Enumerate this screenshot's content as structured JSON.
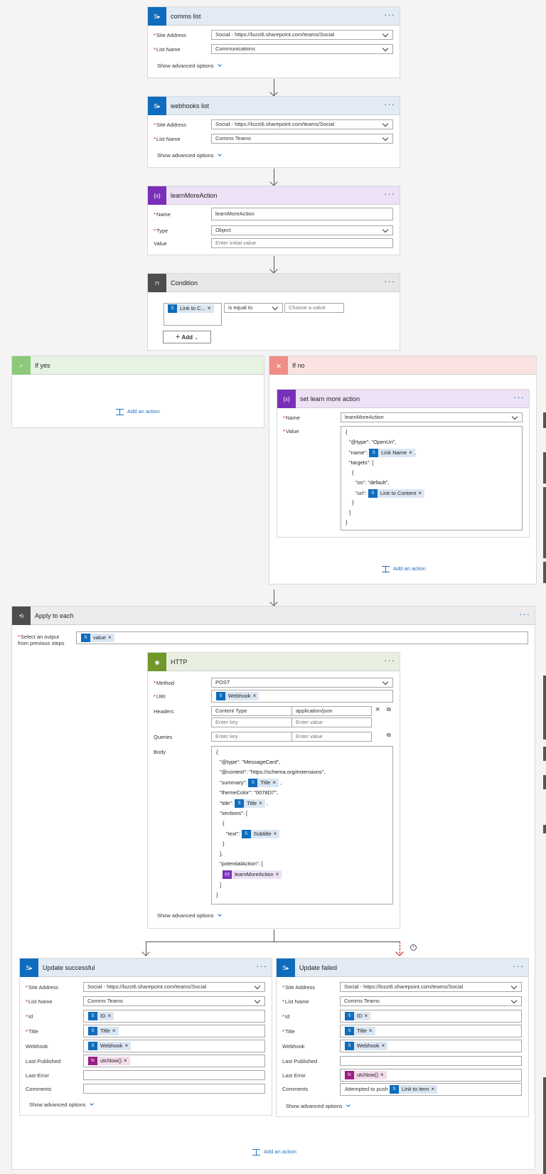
{
  "comms": {
    "title": "comms list",
    "site_label": "Site Address",
    "site_value": "Social - https://lozzi6.sharepoint.com/teams/Social",
    "list_label": "List Name",
    "list_value": "Communications",
    "advanced": "Show advanced options"
  },
  "webhooks": {
    "title": "webhooks list",
    "site_label": "Site Address",
    "site_value": "Social - https://lozzi6.sharepoint.com/teams/Social",
    "list_label": "List Name",
    "list_value": "Comms Teams",
    "advanced": "Show advanced options"
  },
  "lma": {
    "title": "learnMoreAction",
    "name_label": "Name",
    "name_value": "learnMoreAction",
    "type_label": "Type",
    "type_value": "Object",
    "value_label": "Value",
    "value_placeholder": "Enter initial value"
  },
  "condition": {
    "title": "Condition",
    "token": "Link to C...",
    "operator": "is equal to",
    "choose": "Choose a value",
    "add": "Add"
  },
  "yes": {
    "title": "If yes",
    "add_action": "Add an action"
  },
  "no": {
    "title": "If no",
    "add_action": "Add an action",
    "set": {
      "title": "set learn more action",
      "name_label": "Name",
      "name_value": "learnMoreAction",
      "value_label": "Value",
      "lines": [
        "{",
        "\"@type\": \"OpenUri\",",
        "\"name\":",
        ",",
        "\"targets\": [",
        "{",
        "\"os\": \"default\",",
        "\"uri\":",
        "}",
        "]",
        "}"
      ],
      "tok_name": "Link Name",
      "tok_uri": "Link to Content"
    }
  },
  "apply": {
    "title": "Apply to each",
    "select_label_1": "Select an output",
    "select_label_2": "from previous steps",
    "token": "value"
  },
  "http": {
    "title": "HTTP",
    "method_label": "Method",
    "method_value": "POST",
    "uri_label": "URI",
    "uri_token": "Webhook",
    "headers_label": "Headers",
    "header_key": "Content Type",
    "header_value": "application/json",
    "enter_key": "Enter key",
    "enter_value": "Enter value",
    "queries_label": "Queries",
    "body_label": "Body",
    "body": {
      "l1": "{",
      "l2": "\"@type\": \"MessageCard\",",
      "l3": "\"@context\": \"https://schema.org/extensions\",",
      "l4": "\"summary\":",
      "l5": "\"themeColor\": \"0078D7\",",
      "l6": "\"title\":",
      "l7": "\"sections\": [",
      "l8": "{",
      "l9": "\"text\":",
      "l10": "}",
      "l11": "],",
      "l12": "\"potentialAction\": [",
      "l13": "]",
      "l14": "}",
      "comma": ","
    },
    "tok_title": "Title",
    "tok_subtitle": "Subtitle",
    "tok_lma": "learnMoreAction",
    "advanced": "Show advanced options"
  },
  "success": {
    "title": "Update successful",
    "site_label": "Site Address",
    "site_value": "Social - https://lozzi6.sharepoint.com/teams/Social",
    "list_label": "List Name",
    "list_value": "Comms Teams",
    "id_label": "Id",
    "id_tok": "ID",
    "title_label": "Title",
    "title_tok": "Title",
    "webhook_label": "Webhook",
    "webhook_tok": "Webhook",
    "published_label": "Last Published",
    "published_tok": "utcNow()",
    "error_label": "Last Error",
    "comments_label": "Comments",
    "advanced": "Show advanced options"
  },
  "failed": {
    "title": "Update failed",
    "site_label": "Site Address",
    "site_value": "Social - https://lozzi6.sharepoint.com/teams/Social",
    "list_label": "List Name",
    "list_value": "Comms Teams",
    "id_label": "Id",
    "id_tok": "ID",
    "title_label": "Title",
    "title_tok": "Title",
    "webhook_label": "Webhook",
    "webhook_tok": "Webhook",
    "published_label": "Last Published",
    "error_label": "Last Error",
    "error_tok": "utcNow()",
    "comments_label": "Comments",
    "comments_text": "Attempted to push",
    "comments_tok": "Link to item",
    "advanced": "Show advanced options"
  },
  "bottom_add_action": "Add an action",
  "icons": {
    "sharepoint": "sharepoint-icon",
    "variable": "variable-icon",
    "condition": "condition-icon",
    "http": "http-icon",
    "check": "check-icon",
    "close": "close-icon",
    "loop": "loop-icon",
    "info": "info-icon"
  }
}
